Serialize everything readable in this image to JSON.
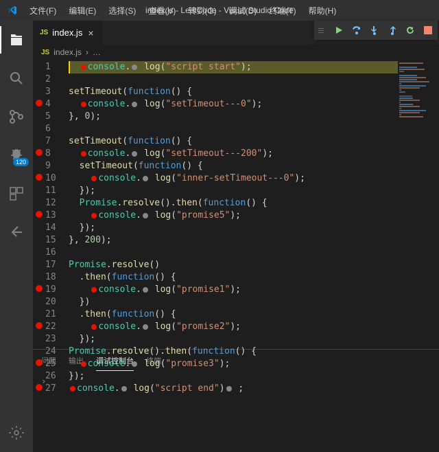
{
  "title": "index.js - LeetCode - Visual Studio Code",
  "menu": [
    "文件(F)",
    "编辑(E)",
    "选择(S)",
    "查看(V)",
    "转到(G)",
    "调试(D)",
    "终端(T)",
    "帮助(H)"
  ],
  "tab": {
    "icon": "JS",
    "label": "index.js",
    "close": "×"
  },
  "crumbs": {
    "icon": "JS",
    "file": "index.js",
    "sep": "›",
    "more": "…"
  },
  "debug_badge": "120",
  "panel_tabs": [
    "问题",
    "输出",
    "调试控制台",
    "终端"
  ],
  "panel_active": 2,
  "prompt": "›",
  "lines": [
    {
      "n": 1,
      "bp": false,
      "hl": true,
      "arrow": true,
      "shift": 1,
      "tokens": [
        [
          "ibp",
          ""
        ],
        [
          "obj",
          "console"
        ],
        [
          "pun",
          "."
        ],
        [
          "igr",
          ""
        ],
        [
          "fn",
          " log"
        ],
        [
          "pun",
          "("
        ],
        [
          "str",
          "\"script start\""
        ],
        [
          "pun",
          ");"
        ]
      ]
    },
    {
      "n": 2,
      "bp": false,
      "tokens": []
    },
    {
      "n": 3,
      "bp": false,
      "tokens": [
        [
          "fn",
          "setTimeout"
        ],
        [
          "pun",
          "("
        ],
        [
          "kw",
          "function"
        ],
        [
          "pun",
          "() {"
        ]
      ]
    },
    {
      "n": 4,
      "bp": true,
      "shift": 1,
      "tokens": [
        [
          "ibp",
          ""
        ],
        [
          "obj",
          "console"
        ],
        [
          "pun",
          "."
        ],
        [
          "igr",
          ""
        ],
        [
          "fn",
          " log"
        ],
        [
          "pun",
          "("
        ],
        [
          "str",
          "\"setTimeout---0\""
        ],
        [
          "pun",
          ");"
        ]
      ]
    },
    {
      "n": 5,
      "bp": false,
      "tokens": [
        [
          "pun",
          "}, "
        ],
        [
          "num",
          "0"
        ],
        [
          "pun",
          ");"
        ]
      ]
    },
    {
      "n": 6,
      "bp": false,
      "tokens": []
    },
    {
      "n": 7,
      "bp": false,
      "tokens": [
        [
          "fn",
          "setTimeout"
        ],
        [
          "pun",
          "("
        ],
        [
          "kw",
          "function"
        ],
        [
          "pun",
          "() {"
        ]
      ]
    },
    {
      "n": 8,
      "bp": true,
      "shift": 1,
      "tokens": [
        [
          "ibp",
          ""
        ],
        [
          "obj",
          "console"
        ],
        [
          "pun",
          "."
        ],
        [
          "igr",
          ""
        ],
        [
          "fn",
          " log"
        ],
        [
          "pun",
          "("
        ],
        [
          "str",
          "\"setTimeout---200\""
        ],
        [
          "pun",
          ");"
        ]
      ]
    },
    {
      "n": 9,
      "bp": false,
      "shift": 1,
      "tokens": [
        [
          "fn",
          "setTimeout"
        ],
        [
          "pun",
          "("
        ],
        [
          "kw",
          "function"
        ],
        [
          "pun",
          "() {"
        ]
      ]
    },
    {
      "n": 10,
      "bp": true,
      "shift": 2,
      "tokens": [
        [
          "ibp",
          ""
        ],
        [
          "obj",
          "console"
        ],
        [
          "pun",
          "."
        ],
        [
          "igr",
          ""
        ],
        [
          "fn",
          " log"
        ],
        [
          "pun",
          "("
        ],
        [
          "str",
          "\"inner-setTimeout---0\""
        ],
        [
          "pun",
          ");"
        ]
      ]
    },
    {
      "n": 11,
      "bp": false,
      "shift": 1,
      "tokens": [
        [
          "pun",
          "});"
        ]
      ]
    },
    {
      "n": 12,
      "bp": false,
      "shift": 1,
      "tokens": [
        [
          "obj",
          "Promise"
        ],
        [
          "pun",
          "."
        ],
        [
          "fn",
          "resolve"
        ],
        [
          "pun",
          "()."
        ],
        [
          "fn",
          "then"
        ],
        [
          "pun",
          "("
        ],
        [
          "kw",
          "function"
        ],
        [
          "pun",
          "() {"
        ]
      ]
    },
    {
      "n": 13,
      "bp": true,
      "shift": 2,
      "tokens": [
        [
          "ibp",
          ""
        ],
        [
          "obj",
          "console"
        ],
        [
          "pun",
          "."
        ],
        [
          "igr",
          ""
        ],
        [
          "fn",
          " log"
        ],
        [
          "pun",
          "("
        ],
        [
          "str",
          "\"promise5\""
        ],
        [
          "pun",
          ");"
        ]
      ]
    },
    {
      "n": 14,
      "bp": false,
      "shift": 1,
      "tokens": [
        [
          "pun",
          "});"
        ]
      ]
    },
    {
      "n": 15,
      "bp": false,
      "tokens": [
        [
          "pun",
          "}, "
        ],
        [
          "num",
          "200"
        ],
        [
          "pun",
          ");"
        ]
      ]
    },
    {
      "n": 16,
      "bp": false,
      "tokens": []
    },
    {
      "n": 17,
      "bp": false,
      "tokens": [
        [
          "obj",
          "Promise"
        ],
        [
          "pun",
          "."
        ],
        [
          "fn",
          "resolve"
        ],
        [
          "pun",
          "()"
        ]
      ]
    },
    {
      "n": 18,
      "bp": false,
      "shift": 1,
      "tokens": [
        [
          "pun",
          "."
        ],
        [
          "fn",
          "then"
        ],
        [
          "pun",
          "("
        ],
        [
          "kw",
          "function"
        ],
        [
          "pun",
          "() {"
        ]
      ]
    },
    {
      "n": 19,
      "bp": true,
      "shift": 2,
      "tokens": [
        [
          "ibp",
          ""
        ],
        [
          "obj",
          "console"
        ],
        [
          "pun",
          "."
        ],
        [
          "igr",
          ""
        ],
        [
          "fn",
          " log"
        ],
        [
          "pun",
          "("
        ],
        [
          "str",
          "\"promise1\""
        ],
        [
          "pun",
          ");"
        ]
      ]
    },
    {
      "n": 20,
      "bp": false,
      "shift": 1,
      "tokens": [
        [
          "pun",
          "})"
        ]
      ]
    },
    {
      "n": 21,
      "bp": false,
      "shift": 1,
      "tokens": [
        [
          "pun",
          "."
        ],
        [
          "fn",
          "then"
        ],
        [
          "pun",
          "("
        ],
        [
          "kw",
          "function"
        ],
        [
          "pun",
          "() {"
        ]
      ]
    },
    {
      "n": 22,
      "bp": true,
      "shift": 2,
      "tokens": [
        [
          "ibp",
          ""
        ],
        [
          "obj",
          "console"
        ],
        [
          "pun",
          "."
        ],
        [
          "igr",
          ""
        ],
        [
          "fn",
          " log"
        ],
        [
          "pun",
          "("
        ],
        [
          "str",
          "\"promise2\""
        ],
        [
          "pun",
          ");"
        ]
      ]
    },
    {
      "n": 23,
      "bp": false,
      "shift": 1,
      "tokens": [
        [
          "pun",
          "});"
        ]
      ]
    },
    {
      "n": 24,
      "bp": false,
      "tokens": [
        [
          "obj",
          "Promise"
        ],
        [
          "pun",
          "."
        ],
        [
          "fn",
          "resolve"
        ],
        [
          "pun",
          "()."
        ],
        [
          "fn",
          "then"
        ],
        [
          "pun",
          "("
        ],
        [
          "kw",
          "function"
        ],
        [
          "pun",
          "() {"
        ]
      ]
    },
    {
      "n": 25,
      "bp": true,
      "shift": 1,
      "tokens": [
        [
          "ibp",
          ""
        ],
        [
          "obj",
          "console"
        ],
        [
          "pun",
          "."
        ],
        [
          "igr",
          ""
        ],
        [
          "fn",
          " log"
        ],
        [
          "pun",
          "("
        ],
        [
          "str",
          "\"promise3\""
        ],
        [
          "pun",
          ");"
        ]
      ]
    },
    {
      "n": 26,
      "bp": false,
      "tokens": [
        [
          "pun",
          "});"
        ]
      ]
    },
    {
      "n": 27,
      "bp": true,
      "tokens": [
        [
          "ibp",
          ""
        ],
        [
          "obj",
          "console"
        ],
        [
          "pun",
          "."
        ],
        [
          "igr",
          ""
        ],
        [
          "fn",
          " log"
        ],
        [
          "pun",
          "("
        ],
        [
          "str",
          "\"script end\""
        ],
        [
          "pun",
          ")"
        ],
        [
          "igr",
          ""
        ],
        [
          "pun",
          " ;"
        ]
      ]
    }
  ]
}
